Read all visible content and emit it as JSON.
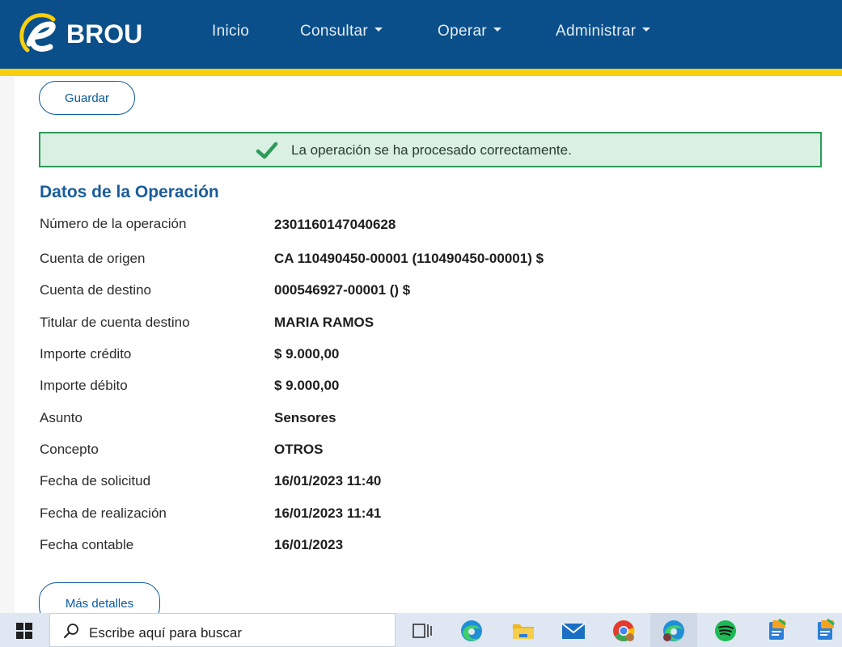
{
  "header": {
    "logo_text": "BROU",
    "nav": [
      {
        "label": "Inicio"
      },
      {
        "label": "Consultar"
      },
      {
        "label": "Operar"
      },
      {
        "label": "Administrar"
      }
    ]
  },
  "actions": {
    "save_label": "Guardar",
    "more_details_label": "Más detalles"
  },
  "alert": {
    "message": "La operación se ha procesado correctamente."
  },
  "operation": {
    "title": "Datos de la Operación",
    "rows": [
      {
        "label": "Número de la operación",
        "value": "2301160147040628"
      },
      {
        "label": "Cuenta de origen",
        "value": "CA 110490450-00001 (110490450-00001) $"
      },
      {
        "label": "Cuenta de destino",
        "value": "000546927-00001 () $"
      },
      {
        "label": "Titular de cuenta destino",
        "value": "MARIA RAMOS"
      },
      {
        "label": "Importe crédito",
        "value": "$ 9.000,00"
      },
      {
        "label": "Importe débito",
        "value": "$ 9.000,00"
      },
      {
        "label": "Asunto",
        "value": "Sensores"
      },
      {
        "label": "Concepto",
        "value": "OTROS"
      },
      {
        "label": "Fecha de solicitud",
        "value": "16/01/2023 11:40"
      },
      {
        "label": "Fecha de realización",
        "value": "16/01/2023 11:41"
      },
      {
        "label": "Fecha contable",
        "value": "16/01/2023"
      }
    ]
  },
  "taskbar": {
    "search_placeholder": "Escribe aquí para buscar",
    "icons": [
      "task-view-icon",
      "edge-icon",
      "file-explorer-icon",
      "mail-icon",
      "chrome-icon",
      "edge-profile-icon",
      "spotify-icon",
      "notes-icon",
      "notes-alt-icon"
    ]
  },
  "colors": {
    "header_blue": "#0a4f8a",
    "header_stripe": "#f7cf0e",
    "success_green": "#2d9a57",
    "success_bg": "#d9f0e3",
    "section_title": "#1a5d99"
  }
}
